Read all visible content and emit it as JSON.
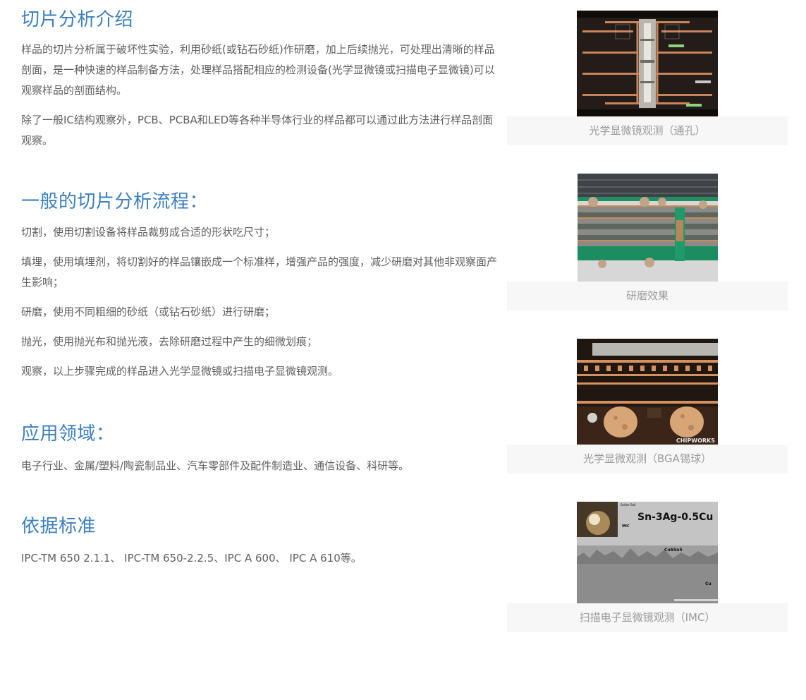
{
  "intro": {
    "title": "切片分析介绍",
    "paragraphs": [
      "样品的切片分析属于破坏性实验，利用砂纸(或钻石砂纸)作研磨，加上后续抛光，可处理出清晰的样品剖面，是一种快速的样品制备方法，处理样品搭配相应的检测设备(光学显微镜或扫描电子显微镜)可以观察样品的剖面结构。",
      "除了一般IC结构观察外，PCB、PCBA和LED等各种半导体行业的样品都可以通过此方法进行样品剖面观察。"
    ]
  },
  "process": {
    "title": "一般的切片分析流程：",
    "steps": [
      "切割，使用切割设备将样品裁剪成合适的形状吃尺寸；",
      "填埋，使用填埋剂，将切割好的样品镶嵌成一个标准样，增强产品的强度，减少研磨对其他非观察面产生影响；",
      "研磨，使用不同粗细的砂纸（或钻石砂纸）进行研磨；",
      "抛光，使用抛光布和抛光液，去除研磨过程中产生的细微划痕；",
      "观察，以上步骤完成的样品进入光学显微镜或扫描电子显微镜观测。"
    ]
  },
  "application": {
    "title": "应用领域：",
    "text": "电子行业、金属/塑料/陶瓷制品业、汽车零部件及配件制造业、通信设备、科研等。"
  },
  "standards": {
    "title": "依据标准",
    "text": "IPC-TM 650 2.1.1、 IPC-TM 650-2.2.5、IPC A 600、 IPC A 610等。"
  },
  "figures": [
    {
      "caption": "光学显微镜观测（通孔）"
    },
    {
      "caption": "研磨效果"
    },
    {
      "caption": "光学显微观测（BGA锡球）",
      "watermark": "CHIPWORKS"
    },
    {
      "caption": "扫描电子显微镜观测（IMC）",
      "labels": {
        "alloy": "Sn-3Ag-0.5Cu",
        "solder": "Solder Ball",
        "imc": "IMC",
        "compound": "Cu6Sn5",
        "cu": "Cu"
      }
    }
  ]
}
